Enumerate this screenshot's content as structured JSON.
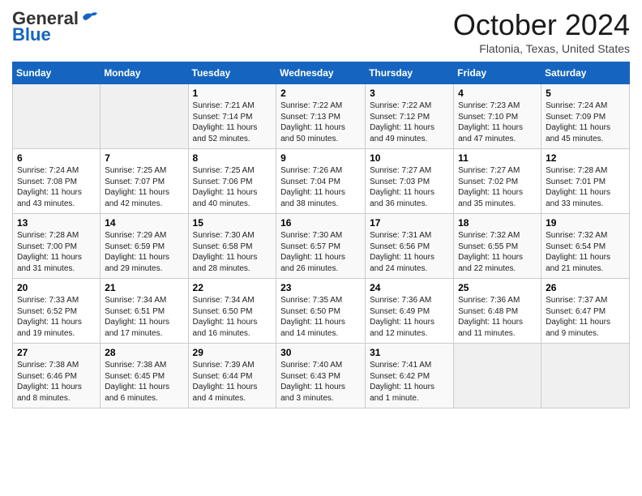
{
  "header": {
    "logo_general": "General",
    "logo_blue": "Blue",
    "month_title": "October 2024",
    "location": "Flatonia, Texas, United States"
  },
  "days_of_week": [
    "Sunday",
    "Monday",
    "Tuesday",
    "Wednesday",
    "Thursday",
    "Friday",
    "Saturday"
  ],
  "weeks": [
    [
      {
        "day": "",
        "sunrise": "",
        "sunset": "",
        "daylight": "",
        "empty": true
      },
      {
        "day": "",
        "sunrise": "",
        "sunset": "",
        "daylight": "",
        "empty": true
      },
      {
        "day": "1",
        "sunrise": "Sunrise: 7:21 AM",
        "sunset": "Sunset: 7:14 PM",
        "daylight": "Daylight: 11 hours and 52 minutes."
      },
      {
        "day": "2",
        "sunrise": "Sunrise: 7:22 AM",
        "sunset": "Sunset: 7:13 PM",
        "daylight": "Daylight: 11 hours and 50 minutes."
      },
      {
        "day": "3",
        "sunrise": "Sunrise: 7:22 AM",
        "sunset": "Sunset: 7:12 PM",
        "daylight": "Daylight: 11 hours and 49 minutes."
      },
      {
        "day": "4",
        "sunrise": "Sunrise: 7:23 AM",
        "sunset": "Sunset: 7:10 PM",
        "daylight": "Daylight: 11 hours and 47 minutes."
      },
      {
        "day": "5",
        "sunrise": "Sunrise: 7:24 AM",
        "sunset": "Sunset: 7:09 PM",
        "daylight": "Daylight: 11 hours and 45 minutes."
      }
    ],
    [
      {
        "day": "6",
        "sunrise": "Sunrise: 7:24 AM",
        "sunset": "Sunset: 7:08 PM",
        "daylight": "Daylight: 11 hours and 43 minutes."
      },
      {
        "day": "7",
        "sunrise": "Sunrise: 7:25 AM",
        "sunset": "Sunset: 7:07 PM",
        "daylight": "Daylight: 11 hours and 42 minutes."
      },
      {
        "day": "8",
        "sunrise": "Sunrise: 7:25 AM",
        "sunset": "Sunset: 7:06 PM",
        "daylight": "Daylight: 11 hours and 40 minutes."
      },
      {
        "day": "9",
        "sunrise": "Sunrise: 7:26 AM",
        "sunset": "Sunset: 7:04 PM",
        "daylight": "Daylight: 11 hours and 38 minutes."
      },
      {
        "day": "10",
        "sunrise": "Sunrise: 7:27 AM",
        "sunset": "Sunset: 7:03 PM",
        "daylight": "Daylight: 11 hours and 36 minutes."
      },
      {
        "day": "11",
        "sunrise": "Sunrise: 7:27 AM",
        "sunset": "Sunset: 7:02 PM",
        "daylight": "Daylight: 11 hours and 35 minutes."
      },
      {
        "day": "12",
        "sunrise": "Sunrise: 7:28 AM",
        "sunset": "Sunset: 7:01 PM",
        "daylight": "Daylight: 11 hours and 33 minutes."
      }
    ],
    [
      {
        "day": "13",
        "sunrise": "Sunrise: 7:28 AM",
        "sunset": "Sunset: 7:00 PM",
        "daylight": "Daylight: 11 hours and 31 minutes."
      },
      {
        "day": "14",
        "sunrise": "Sunrise: 7:29 AM",
        "sunset": "Sunset: 6:59 PM",
        "daylight": "Daylight: 11 hours and 29 minutes."
      },
      {
        "day": "15",
        "sunrise": "Sunrise: 7:30 AM",
        "sunset": "Sunset: 6:58 PM",
        "daylight": "Daylight: 11 hours and 28 minutes."
      },
      {
        "day": "16",
        "sunrise": "Sunrise: 7:30 AM",
        "sunset": "Sunset: 6:57 PM",
        "daylight": "Daylight: 11 hours and 26 minutes."
      },
      {
        "day": "17",
        "sunrise": "Sunrise: 7:31 AM",
        "sunset": "Sunset: 6:56 PM",
        "daylight": "Daylight: 11 hours and 24 minutes."
      },
      {
        "day": "18",
        "sunrise": "Sunrise: 7:32 AM",
        "sunset": "Sunset: 6:55 PM",
        "daylight": "Daylight: 11 hours and 22 minutes."
      },
      {
        "day": "19",
        "sunrise": "Sunrise: 7:32 AM",
        "sunset": "Sunset: 6:54 PM",
        "daylight": "Daylight: 11 hours and 21 minutes."
      }
    ],
    [
      {
        "day": "20",
        "sunrise": "Sunrise: 7:33 AM",
        "sunset": "Sunset: 6:52 PM",
        "daylight": "Daylight: 11 hours and 19 minutes."
      },
      {
        "day": "21",
        "sunrise": "Sunrise: 7:34 AM",
        "sunset": "Sunset: 6:51 PM",
        "daylight": "Daylight: 11 hours and 17 minutes."
      },
      {
        "day": "22",
        "sunrise": "Sunrise: 7:34 AM",
        "sunset": "Sunset: 6:50 PM",
        "daylight": "Daylight: 11 hours and 16 minutes."
      },
      {
        "day": "23",
        "sunrise": "Sunrise: 7:35 AM",
        "sunset": "Sunset: 6:50 PM",
        "daylight": "Daylight: 11 hours and 14 minutes."
      },
      {
        "day": "24",
        "sunrise": "Sunrise: 7:36 AM",
        "sunset": "Sunset: 6:49 PM",
        "daylight": "Daylight: 11 hours and 12 minutes."
      },
      {
        "day": "25",
        "sunrise": "Sunrise: 7:36 AM",
        "sunset": "Sunset: 6:48 PM",
        "daylight": "Daylight: 11 hours and 11 minutes."
      },
      {
        "day": "26",
        "sunrise": "Sunrise: 7:37 AM",
        "sunset": "Sunset: 6:47 PM",
        "daylight": "Daylight: 11 hours and 9 minutes."
      }
    ],
    [
      {
        "day": "27",
        "sunrise": "Sunrise: 7:38 AM",
        "sunset": "Sunset: 6:46 PM",
        "daylight": "Daylight: 11 hours and 8 minutes."
      },
      {
        "day": "28",
        "sunrise": "Sunrise: 7:38 AM",
        "sunset": "Sunset: 6:45 PM",
        "daylight": "Daylight: 11 hours and 6 minutes."
      },
      {
        "day": "29",
        "sunrise": "Sunrise: 7:39 AM",
        "sunset": "Sunset: 6:44 PM",
        "daylight": "Daylight: 11 hours and 4 minutes."
      },
      {
        "day": "30",
        "sunrise": "Sunrise: 7:40 AM",
        "sunset": "Sunset: 6:43 PM",
        "daylight": "Daylight: 11 hours and 3 minutes."
      },
      {
        "day": "31",
        "sunrise": "Sunrise: 7:41 AM",
        "sunset": "Sunset: 6:42 PM",
        "daylight": "Daylight: 11 hours and 1 minute."
      },
      {
        "day": "",
        "sunrise": "",
        "sunset": "",
        "daylight": "",
        "empty": true
      },
      {
        "day": "",
        "sunrise": "",
        "sunset": "",
        "daylight": "",
        "empty": true
      }
    ]
  ]
}
